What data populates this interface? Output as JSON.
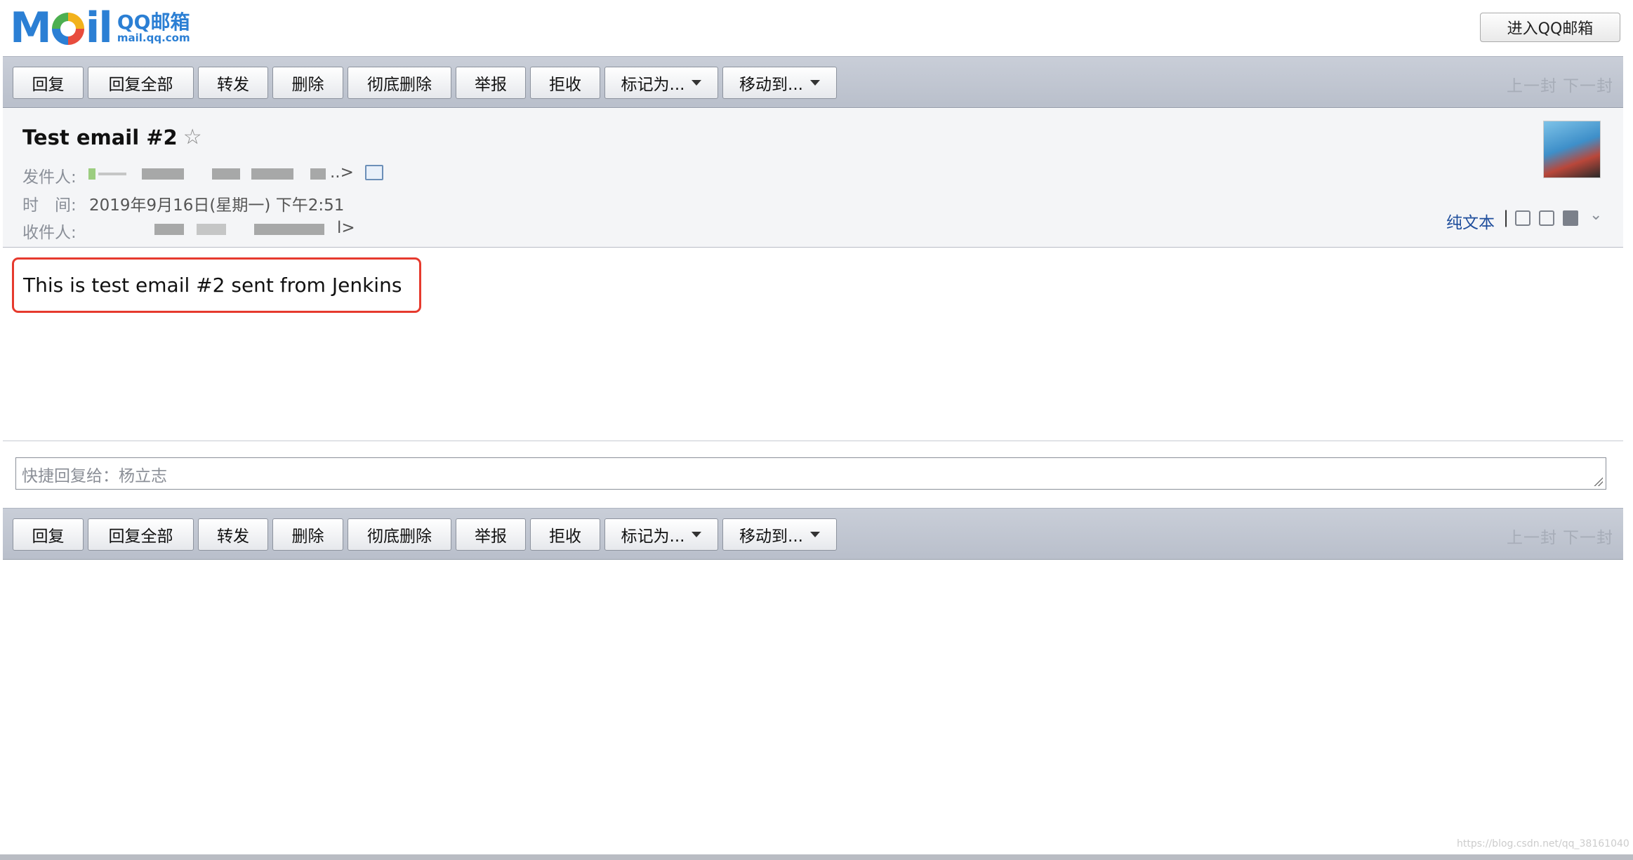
{
  "logo": {
    "mark_left": "M",
    "mark_right": "il",
    "title": "QQ邮箱",
    "subtitle": "mail.qq.com"
  },
  "header": {
    "enter_button": "进入QQ邮箱"
  },
  "toolbar": {
    "buttons": [
      "回复",
      "回复全部",
      "转发",
      "删除",
      "彻底删除",
      "举报",
      "拒收",
      "标记为...",
      "移动到..."
    ],
    "prev": "上一封",
    "next": "下一封"
  },
  "mail": {
    "subject": "Test email #2",
    "star": "☆",
    "from_label": "发件人:",
    "from_suffix": "..>",
    "time_label": "时　间:",
    "time_value": "2019年9月16日(星期一) 下午2:51",
    "to_label": "收件人:",
    "to_suffix": "l>",
    "plain_text_link": "纯文本",
    "separator": "|",
    "body": "This is test email #2 sent from Jenkins"
  },
  "quick_reply": {
    "placeholder": "快捷回复给：杨立志"
  },
  "watermark": "https://blog.csdn.net/qq_38161040",
  "colors": {
    "brand": "#2b7fd4",
    "highlight": "#e63a2e",
    "toolbar": "#c3c8d2",
    "link": "#1f4e9c"
  }
}
